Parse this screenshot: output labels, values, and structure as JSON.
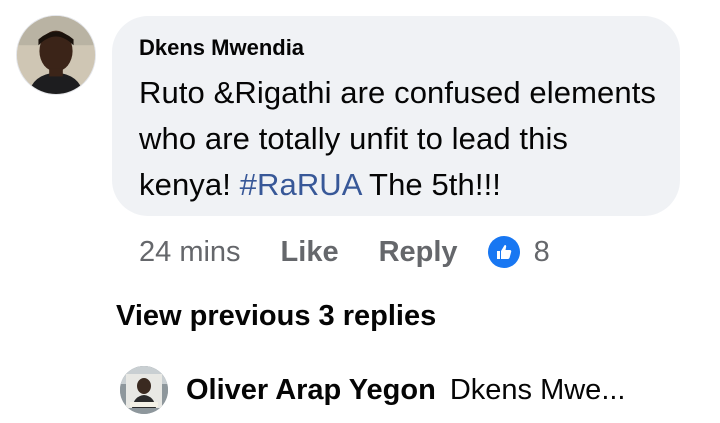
{
  "comment": {
    "author": "Dkens Mwendia",
    "text_before_hashtag": "Ruto &Rigathi are confused elements who are totally unfit to lead this kenya! ",
    "hashtag": "#RaRUA",
    "text_after_hashtag": " The 5th!!!",
    "time": "24 mins",
    "like_label": "Like",
    "reply_label": "Reply",
    "reaction_icon": "thumbs-up-icon",
    "reaction_count": "8"
  },
  "replies": {
    "view_previous_label": "View previous 3 replies",
    "latest": {
      "author": "Oliver Arap Yegon",
      "snippet": "Dkens Mwe..."
    }
  },
  "colors": {
    "bubble_bg": "#f0f2f5",
    "hashtag": "#385898",
    "meta_text": "#65676b",
    "like_blue": "#1877f2"
  }
}
